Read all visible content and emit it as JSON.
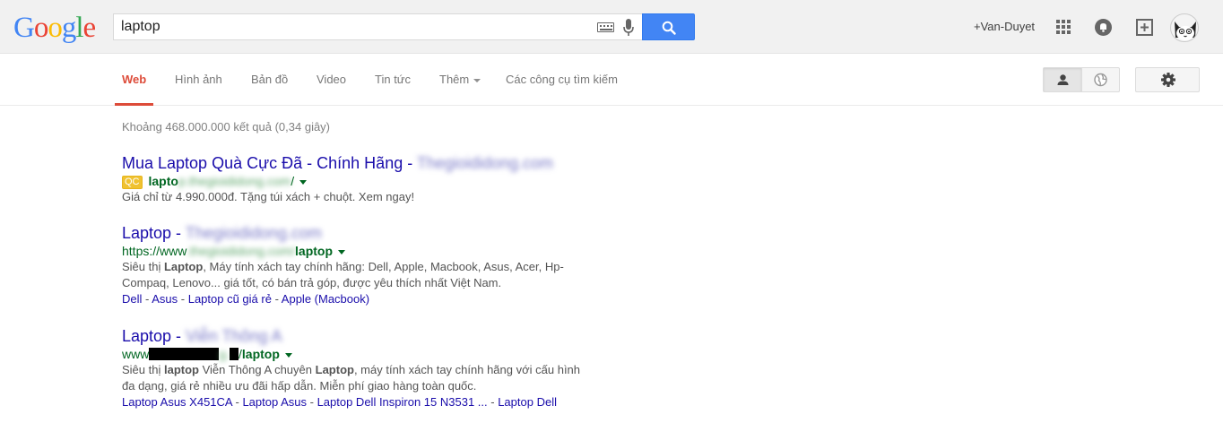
{
  "colors": {
    "header_bg": "#f1f1f1",
    "link_blue": "#1a0dab",
    "url_green": "#006621",
    "tab_active_red": "#dd4b39",
    "search_btn_blue": "#4285f4",
    "ad_badge_yellow": "#f0c230"
  },
  "header": {
    "logo_letters": [
      "G",
      "o",
      "o",
      "g",
      "l",
      "e"
    ],
    "search_value": "laptop",
    "user_name": "+Van-Duyet",
    "icons": [
      "keyboard-icon",
      "microphone-icon",
      "search-icon",
      "apps-grid-icon",
      "notifications-icon",
      "share-box-icon",
      "avatar"
    ]
  },
  "tabs": {
    "web": "Web",
    "images": "Hình ảnh",
    "maps": "Bản đồ",
    "video": "Video",
    "news": "Tin tức",
    "more": "Thêm",
    "tools": "Các công cụ tìm kiếm",
    "icons": [
      "person-icon",
      "globe-icon",
      "gear-icon"
    ]
  },
  "stats": "Khoảng 468.000.000 kết quả (0,34 giây)",
  "results": {
    "ad": {
      "title_prefix": "Mua Laptop Quà Cực Đã - Chính Hãng - ",
      "title_blurred": "Thegioididong.com",
      "badge": "QC",
      "url_bold": "lapto",
      "url_blurred": "p.thegioididong.com",
      "url_suffix": "/",
      "snippet": "Giá chỉ từ 4.990.000đ. Tặng túi xách + chuột. Xem ngay!"
    },
    "r1": {
      "title_prefix": "Laptop - ",
      "title_blurred": "Thegioididong.com",
      "url_prefix": "https://www",
      "url_blurred": ".thegioididong.com/",
      "url_bold": "laptop",
      "snippet_1": "Siêu thị ",
      "snippet_bold": "Laptop",
      "snippet_2": ", Máy tính xách tay chính hãng: Dell, Apple, Macbook, Asus, Acer, Hp-Compaq, Lenovo... giá tốt, có bán trả góp, được yêu thích nhất Việt Nam.",
      "links": [
        "Dell",
        "Asus",
        "Laptop cũ giá rẻ",
        "Apple (Macbook)"
      ],
      "separator": " - "
    },
    "r2": {
      "title_prefix": "Laptop - ",
      "title_blurred": "Viễn Thông A",
      "url_prefix": "www",
      "url_suffix_dim": "g.",
      "url_tail": "/",
      "url_bold": "laptop",
      "snippet_1": "Siêu thị ",
      "snippet_bold_1": "laptop",
      "snippet_2": " Viễn Thông A chuyên  ",
      "snippet_bold_2": "Laptop",
      "snippet_3": ", máy tính xách tay chính hãng với cấu hình đa dạng, giá rẻ nhiều ưu đãi hấp dẫn. Miễn phí giao hàng toàn quốc.",
      "links": [
        "Laptop Asus X451CA",
        "Laptop Asus",
        "Laptop Dell Inspiron 15 N3531 ...",
        "Laptop Dell"
      ],
      "separator": " - "
    }
  }
}
